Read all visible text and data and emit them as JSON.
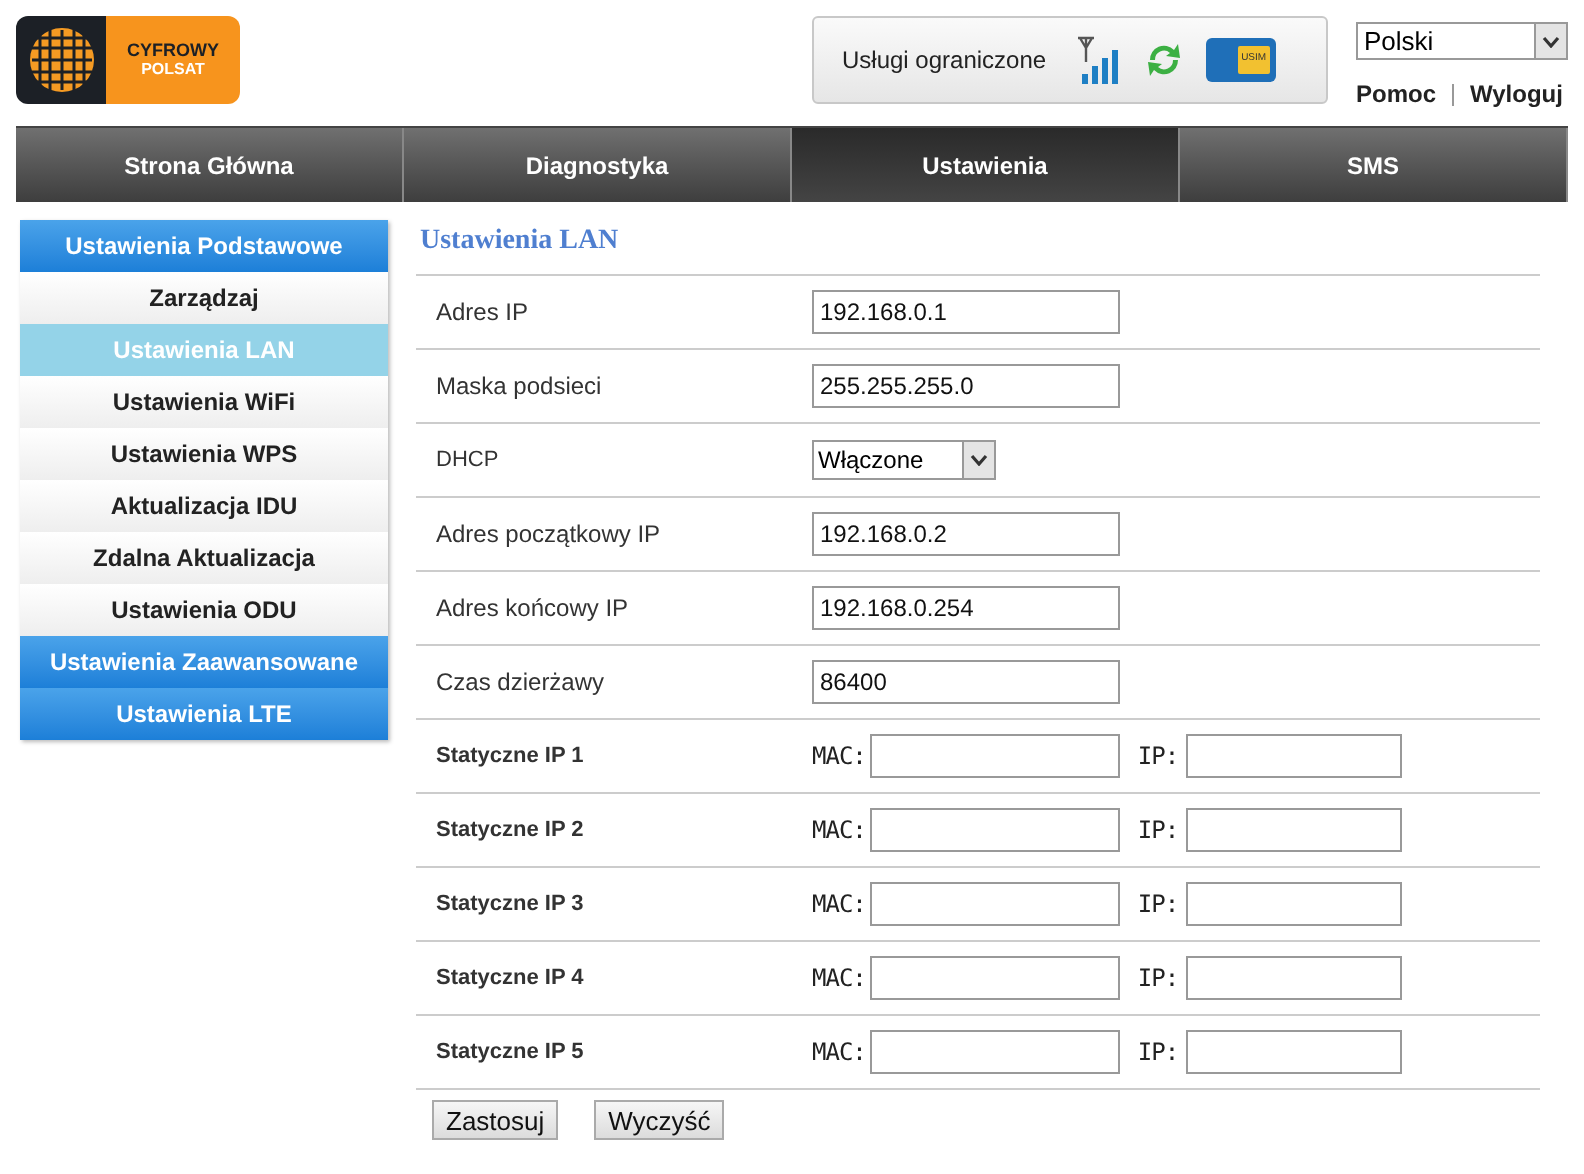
{
  "logo": {
    "line1": "CYFROWY",
    "line2": "POLSAT"
  },
  "status": {
    "text": "Usługi ograniczone",
    "sim": "USIM"
  },
  "language": {
    "value": "Polski"
  },
  "links": [
    "Pomoc",
    "Wyloguj"
  ],
  "tabs": [
    {
      "label": "Strona Główna",
      "selected": false
    },
    {
      "label": "Diagnostyka",
      "selected": false
    },
    {
      "label": "Ustawienia",
      "selected": true
    },
    {
      "label": "SMS",
      "selected": false
    }
  ],
  "sidebar": {
    "items": [
      {
        "label": "Ustawienia Podstawowe",
        "kind": "section",
        "selected": false
      },
      {
        "label": "Zarządzaj",
        "kind": "item",
        "selected": false
      },
      {
        "label": "Ustawienia LAN",
        "kind": "item",
        "selected": true
      },
      {
        "label": "Ustawienia WiFi",
        "kind": "item",
        "selected": false
      },
      {
        "label": "Ustawienia WPS",
        "kind": "item",
        "selected": false
      },
      {
        "label": "Aktualizacja IDU",
        "kind": "item",
        "selected": false
      },
      {
        "label": "Zdalna Aktualizacja",
        "kind": "item",
        "selected": false
      },
      {
        "label": "Ustawienia ODU",
        "kind": "item",
        "selected": false
      },
      {
        "label": "Ustawienia Zaawansowane",
        "kind": "section",
        "selected": false
      },
      {
        "label": "Ustawienia LTE",
        "kind": "section",
        "selected": false
      }
    ]
  },
  "form": {
    "title": "Ustawienia LAN",
    "rows": [
      {
        "label": "Adres IP",
        "kind": "text",
        "value": "192.168.0.1"
      },
      {
        "label": "Maska podsieci",
        "kind": "text",
        "value": "255.255.255.0"
      },
      {
        "label": "DHCP",
        "kind": "select",
        "value": "Włączone"
      },
      {
        "label": "Adres początkowy IP",
        "kind": "text",
        "value": "192.168.0.2"
      },
      {
        "label": "Adres końcowy IP",
        "kind": "text",
        "value": "192.168.0.254"
      },
      {
        "label": "Czas dzierżawy",
        "kind": "text",
        "value": "86400"
      },
      {
        "label": "Statyczne IP 1",
        "kind": "static",
        "mac_label": "MAC:",
        "ip_label": "IP:"
      },
      {
        "label": "Statyczne IP 2",
        "kind": "static",
        "mac_label": "MAC:",
        "ip_label": "IP:"
      },
      {
        "label": "Statyczne IP 3",
        "kind": "static",
        "mac_label": "MAC:",
        "ip_label": "IP:"
      },
      {
        "label": "Statyczne IP 4",
        "kind": "static",
        "mac_label": "MAC:",
        "ip_label": "IP:"
      },
      {
        "label": "Statyczne IP 5",
        "kind": "static",
        "mac_label": "MAC:",
        "ip_label": "IP:"
      }
    ],
    "buttons": [
      "Zastosuj",
      "Wyczyść"
    ]
  }
}
